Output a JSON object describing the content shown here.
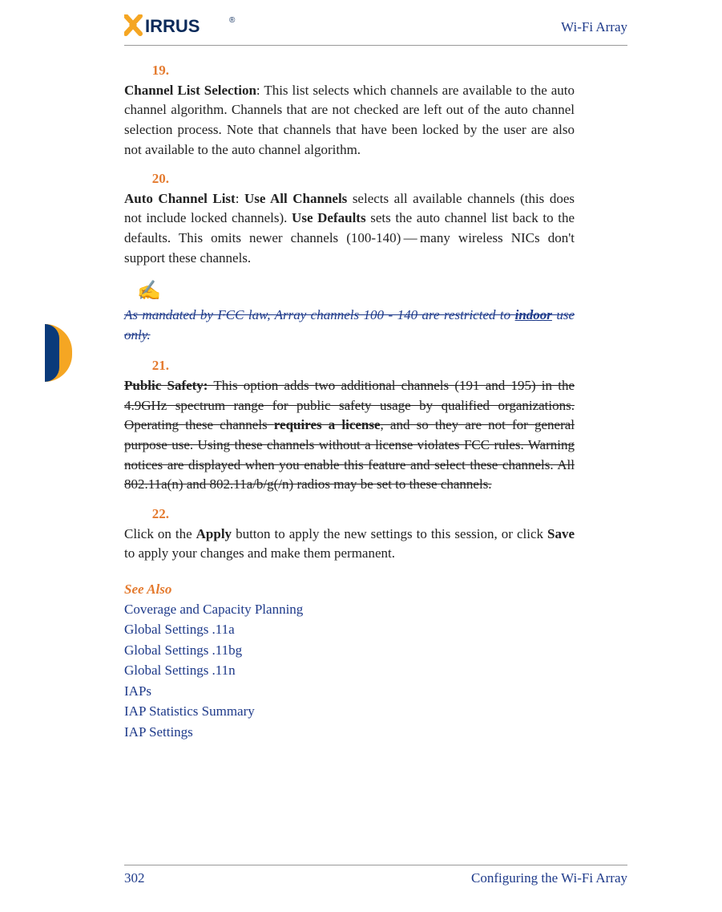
{
  "header": {
    "product": "Wi-Fi Array"
  },
  "logo": {
    "brand_text": "XIRRUS"
  },
  "items": {
    "n19": "19.",
    "t19_bold": "Channel List Selection",
    "t19_rest": ": This list selects which channels are available to the auto channel algorithm. Channels that are not checked are left out of the auto channel selection process. Note that channels that have been locked by the user are also not available to the auto channel algorithm.",
    "n20": "20.",
    "t20_bold1": "Auto Channel List",
    "t20_sep": ": ",
    "t20_bold2": "Use All Channels",
    "t20_mid1": " selects all available channels (this does not include locked channels). ",
    "t20_bold3": "Use Defaults",
    "t20_mid2": " sets the auto channel list back to the defaults. This omits newer channels (100-140) — many wireless NICs don't support these channels.",
    "note_pre": "As mandated by FCC law, Array channels 100 - 140 are restricted to ",
    "note_bold": "indoor",
    "note_post": " use only.",
    "n21": "21.",
    "t21_bold1": "Public Safety:",
    "t21_mid1": " This option adds two additional channels (191 and 195) in the 4.9GHz spectrum range for public safety usage by qualified organizations. Operating these channels ",
    "t21_bold2": "requires a license",
    "t21_mid2": ", and so they are not for general purpose use. Using these channels without a license violates FCC rules. Warning notices are displayed when you enable this feature and select these channels. All 802.11a(n) and 802.11a/b/g(/n) radios may be set to these channels.",
    "n22": "22.",
    "t22_pre": "Click on the ",
    "t22_b1": "Apply",
    "t22_mid": " button to apply the new settings to this session, or click ",
    "t22_b2": "Save",
    "t22_post": " to apply your changes and make them permanent."
  },
  "see_also": {
    "title": "See Also",
    "links": [
      "Coverage and Capacity Planning",
      "Global Settings .11a",
      "Global Settings .11bg",
      "Global Settings .11n",
      "IAPs",
      "IAP Statistics Summary",
      "IAP Settings"
    ]
  },
  "footer": {
    "page": "302",
    "section": "Configuring the Wi-Fi Array"
  }
}
